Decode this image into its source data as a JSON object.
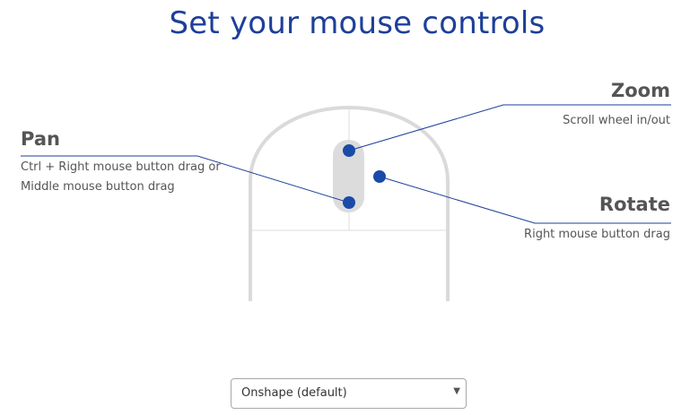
{
  "header": {
    "title": "Set your mouse controls"
  },
  "controls": {
    "zoom": {
      "title": "Zoom",
      "description": "Scroll wheel in/out"
    },
    "pan": {
      "title": "Pan",
      "description_line1": "Ctrl + Right mouse button drag or",
      "description_line2": "Middle mouse button drag"
    },
    "rotate": {
      "title": "Rotate",
      "description": "Right mouse button drag"
    }
  },
  "preset_select": {
    "selected": "Onshape (default)"
  },
  "colors": {
    "title": "#1d3f9a",
    "callout_line": "#1d3f9a",
    "dot": "#1a4ba8",
    "mouse_outline": "#d9d9d9",
    "wheel": "#dcdcdc",
    "text": "#555555"
  },
  "icons": {
    "select_caret": "chevron-down-icon"
  }
}
